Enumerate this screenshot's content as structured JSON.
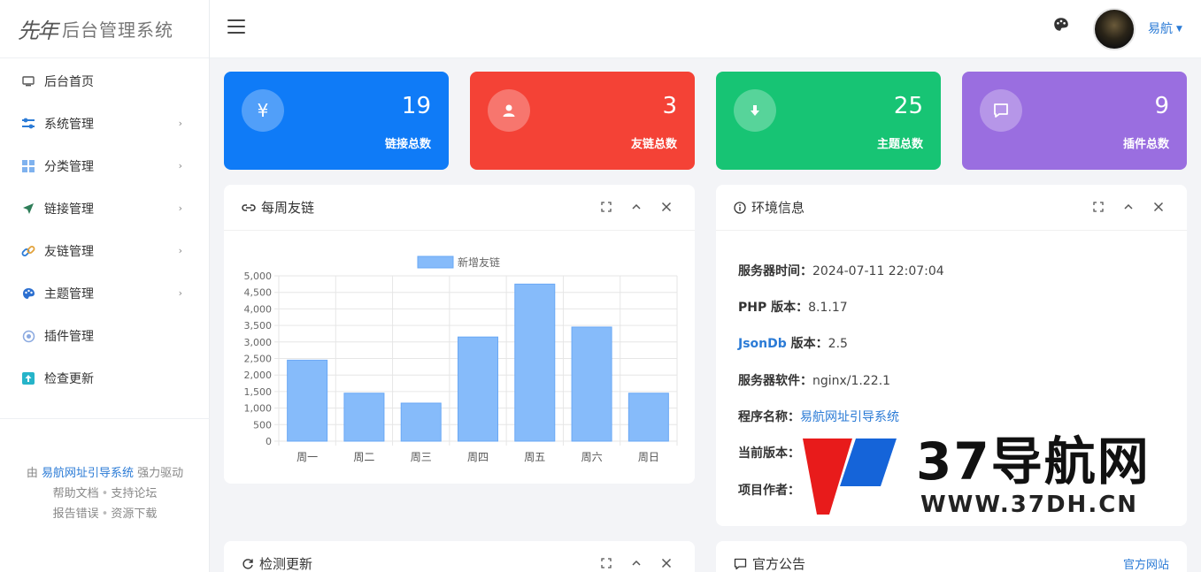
{
  "brand": {
    "mark": "先年",
    "title": "后台管理系统"
  },
  "sidebar": {
    "items": [
      {
        "label": "后台首页",
        "icon": "monitor-icon",
        "submenu": false
      },
      {
        "label": "系统管理",
        "icon": "sliders-icon",
        "submenu": true
      },
      {
        "label": "分类管理",
        "icon": "grid-icon",
        "submenu": true
      },
      {
        "label": "链接管理",
        "icon": "send-icon",
        "submenu": true
      },
      {
        "label": "友链管理",
        "icon": "link-icon",
        "submenu": true
      },
      {
        "label": "主题管理",
        "icon": "palette-icon",
        "submenu": true
      },
      {
        "label": "插件管理",
        "icon": "plugin-icon",
        "submenu": false
      },
      {
        "label": "检查更新",
        "icon": "upload-icon",
        "submenu": false
      }
    ],
    "footer": {
      "prefix": "由",
      "product": "易航网址引导系统",
      "suffix": "强力驱动",
      "links_row1": [
        "帮助文档",
        "支持论坛"
      ],
      "links_row2": [
        "报告错误",
        "资源下载"
      ]
    }
  },
  "header": {
    "username": "易航"
  },
  "stats": [
    {
      "value": "19",
      "label": "链接总数",
      "icon": "yen-icon",
      "color": "#0f7bf7"
    },
    {
      "value": "3",
      "label": "友链总数",
      "icon": "user-icon",
      "color": "#f44236"
    },
    {
      "value": "25",
      "label": "主题总数",
      "icon": "download-icon",
      "color": "#17c474"
    },
    {
      "value": "9",
      "label": "插件总数",
      "icon": "comment-icon",
      "color": "#9a6ee0"
    }
  ],
  "weekly_card": {
    "title": "每周友链"
  },
  "chart_data": {
    "type": "bar",
    "categories": [
      "周一",
      "周二",
      "周三",
      "周四",
      "周五",
      "周六",
      "周日"
    ],
    "series": [
      {
        "name": "新增友链",
        "values": [
          2450,
          1450,
          1150,
          3150,
          4750,
          3450,
          1450
        ]
      }
    ],
    "ylim": [
      0,
      5000
    ],
    "yticks": [
      "0",
      "500",
      "1,000",
      "1,500",
      "2,000",
      "2,500",
      "3,000",
      "3,500",
      "4,000",
      "4,500",
      "5,000"
    ],
    "legend": "top",
    "grid": true,
    "color": "#86bbfa"
  },
  "env_card": {
    "title": "环境信息",
    "rows": [
      {
        "key": "服务器时间：",
        "value": "2024-07-11 22:07:04"
      },
      {
        "key": "PHP 版本：",
        "value": "8.1.17"
      },
      {
        "key_highlight": "JsonDb",
        "key": " 版本：",
        "value": "2.5"
      },
      {
        "key": "服务器软件：",
        "value": "nginx/1.22.1"
      },
      {
        "key": "程序名称：",
        "value": "易航网址引导系统"
      },
      {
        "key": "当前版本：",
        "value": ""
      },
      {
        "key": "项目作者：",
        "value": ""
      }
    ]
  },
  "update_card": {
    "title": "检测更新"
  },
  "notice_card": {
    "title": "官方公告",
    "link": "官方网站"
  },
  "watermark": {
    "big": "37导航网",
    "small": "WWW.37DH.CN"
  }
}
